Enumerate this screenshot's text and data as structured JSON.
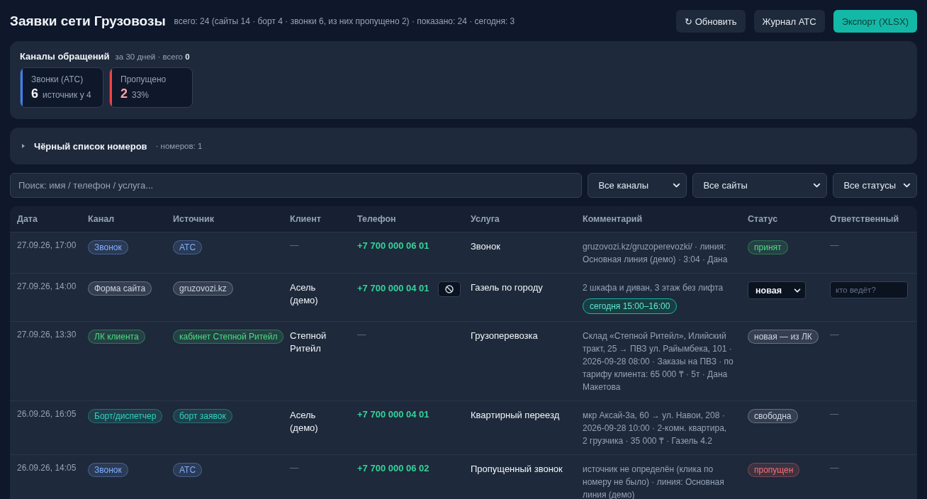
{
  "header": {
    "title": "Заявки сети Грузовозы",
    "summary": "всего: 24 (сайты 14 · борт 4 · звонки 6, из них пропущено 2) · показано: 24 · сегодня: 3",
    "buttons": [
      {
        "label": "↻ Обновить",
        "primary": false
      },
      {
        "label": "Журнал АТС",
        "primary": false
      },
      {
        "label": "Экспорт (XLSX)",
        "primary": true
      }
    ]
  },
  "channels": {
    "title": "Каналы обращений",
    "subtitle": "за 30 дней · всего **0**",
    "cards": [
      {
        "label": "Звонки (АТС)",
        "value": "6",
        "note": "источник у 4",
        "color": "#3b82f6"
      },
      {
        "label": "Пропущено",
        "value": "2",
        "note": "33%",
        "color": "#ef4444"
      }
    ]
  },
  "blacklist": {
    "title": "Чёрный список номеров",
    "note": "· номеров: 1",
    "expanded": false
  },
  "filters": {
    "search": {
      "placeholder": "Поиск: имя / телефон / услуга..."
    },
    "selects": [
      "Все каналы",
      "Все сайты",
      "Все статусы"
    ]
  },
  "table": {
    "columns": [
      "Дата",
      "Канал",
      "Источник",
      "Клиент",
      "Телефон",
      "Услуга",
      "Комментарий",
      "Статус",
      "Ответственный"
    ],
    "rows": [
      {
        "date": "27.09.26, 17:00",
        "channel": {
          "label": "Звонок",
          "color": "#7fb0ff"
        },
        "source": {
          "label": "АТС",
          "color": "#7fb0ff"
        },
        "client": "—",
        "phone": "+7 700 000 06 01",
        "block_button": false,
        "service": "Звонок",
        "comment": "gruzovozi.kz/gruzoperevozki/ · линия: Основная линия (демо) · 3:04 · Дана",
        "status": {
          "kind": "badge",
          "label": "принят",
          "color": "#4ade80"
        },
        "responsible": {
          "kind": "text",
          "text": "—"
        }
      },
      {
        "date": "27.09.26, 14:00",
        "channel": {
          "label": "Форма сайта",
          "color": "#cbd5e1"
        },
        "source": {
          "label": "gruzovozi.kz",
          "color": "#cbd5e1"
        },
        "client": "Асель (демо)",
        "phone": "+7 700 000 04 01",
        "block_button": true,
        "service": "Газель по городу",
        "comment": "2 шкафа и диван, 3 этаж без лифта",
        "slot": "сегодня 15:00–16:00",
        "status": {
          "kind": "select",
          "label": "новая"
        },
        "responsible": {
          "kind": "input",
          "placeholder": "кто ведёт?"
        }
      },
      {
        "date": "27.09.26, 13:30",
        "channel": {
          "label": "ЛК клиента",
          "color": "#4ade80"
        },
        "source": {
          "label": "кабинет Степной Ритейл",
          "color": "#4ade80"
        },
        "client": "Степной Ритейл",
        "phone": "—",
        "block_button": false,
        "service": "Грузоперевозка",
        "comment": "Склад «Степной Ритейл», Илийский тракт, 25 → ПВЗ ул. Райымбека, 101 · 2026-09-28 08:00 · Заказы на ПВЗ · по тарифу клиента: 65 000 ₸ · 5т · Дана Макетова",
        "status": {
          "kind": "badge",
          "label": "новая — из ЛК",
          "color": "#cbd5e1"
        },
        "responsible": {
          "kind": "text",
          "text": "—"
        }
      },
      {
        "date": "26.09.26, 16:05",
        "channel": {
          "label": "Борт/диспетчер",
          "color": "#2dd4bf"
        },
        "source": {
          "label": "борт заявок",
          "color": "#2dd4bf"
        },
        "client": "Асель (демо)",
        "phone": "+7 700 000 04 01",
        "block_button": false,
        "service": "Квартирный переезд",
        "comment": "мкр Аксай-3а, 60 → ул. Навои, 208 · 2026-09-28 10:00 · 2-комн. квартира, 2 грузчика · 35 000 ₸ · Газель 4.2",
        "status": {
          "kind": "badge",
          "label": "свободна",
          "color": "#cbd5e1"
        },
        "responsible": {
          "kind": "text",
          "text": "—"
        }
      },
      {
        "date": "26.09.26, 14:05",
        "channel": {
          "label": "Звонок",
          "color": "#7fb0ff"
        },
        "source": {
          "label": "АТС",
          "color": "#7fb0ff"
        },
        "client": "—",
        "phone": "+7 700 000 06 02",
        "block_button": false,
        "service": "Пропущенный звонок",
        "comment": "источник не определён (клика по номеру не было) · линия: Основная линия (демо)",
        "status": {
          "kind": "badge",
          "label": "пропущен",
          "color": "#f87171"
        },
        "responsible": {
          "kind": "text",
          "text": "—"
        }
      }
    ]
  }
}
